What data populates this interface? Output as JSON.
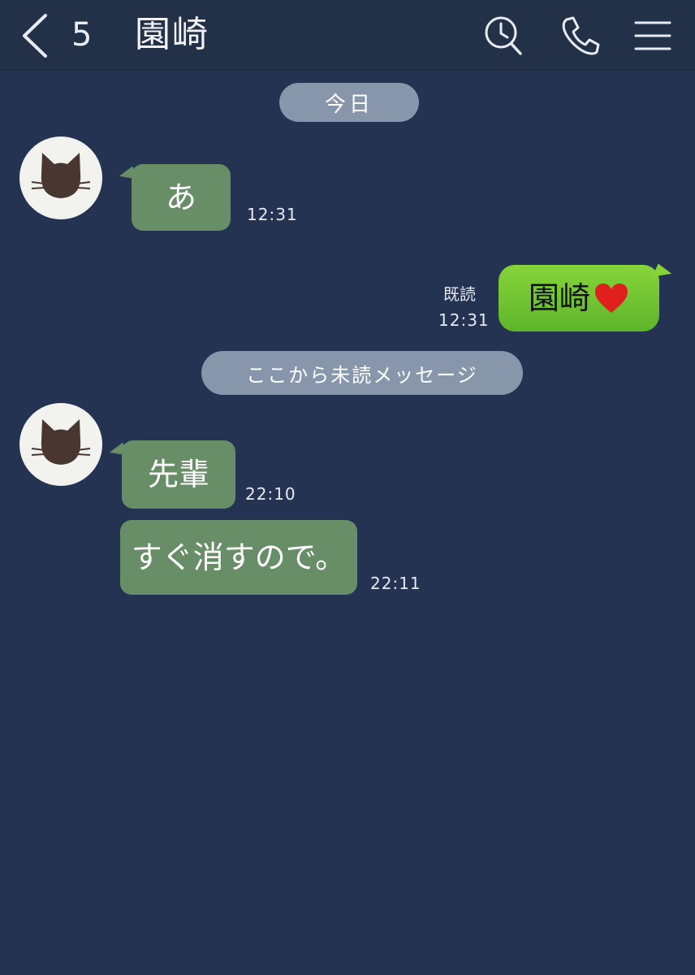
{
  "header": {
    "back_icon": "chevron-left-icon",
    "unread_count": "5",
    "title": "園崎",
    "icons": [
      "search-icon",
      "phone-icon",
      "menu-icon"
    ]
  },
  "chat": {
    "date_label": "今日",
    "unread_divider": "ここから未読メッセージ",
    "messages": [
      {
        "sender": "other",
        "text": "あ",
        "time": "12:31"
      },
      {
        "sender": "me",
        "text": "園崎",
        "emoji": "heart",
        "read_label": "既読",
        "time": "12:31"
      },
      {
        "sender": "other",
        "text": "先輩",
        "time": "22:10"
      },
      {
        "sender": "other",
        "text": "すぐ消すので。",
        "time": "22:11"
      }
    ]
  },
  "colors": {
    "background": "#243352",
    "header": "#223048",
    "pill": "#8796ab",
    "incoming_bubble": "#688e68",
    "outgoing_bubble": "#6cc232"
  }
}
